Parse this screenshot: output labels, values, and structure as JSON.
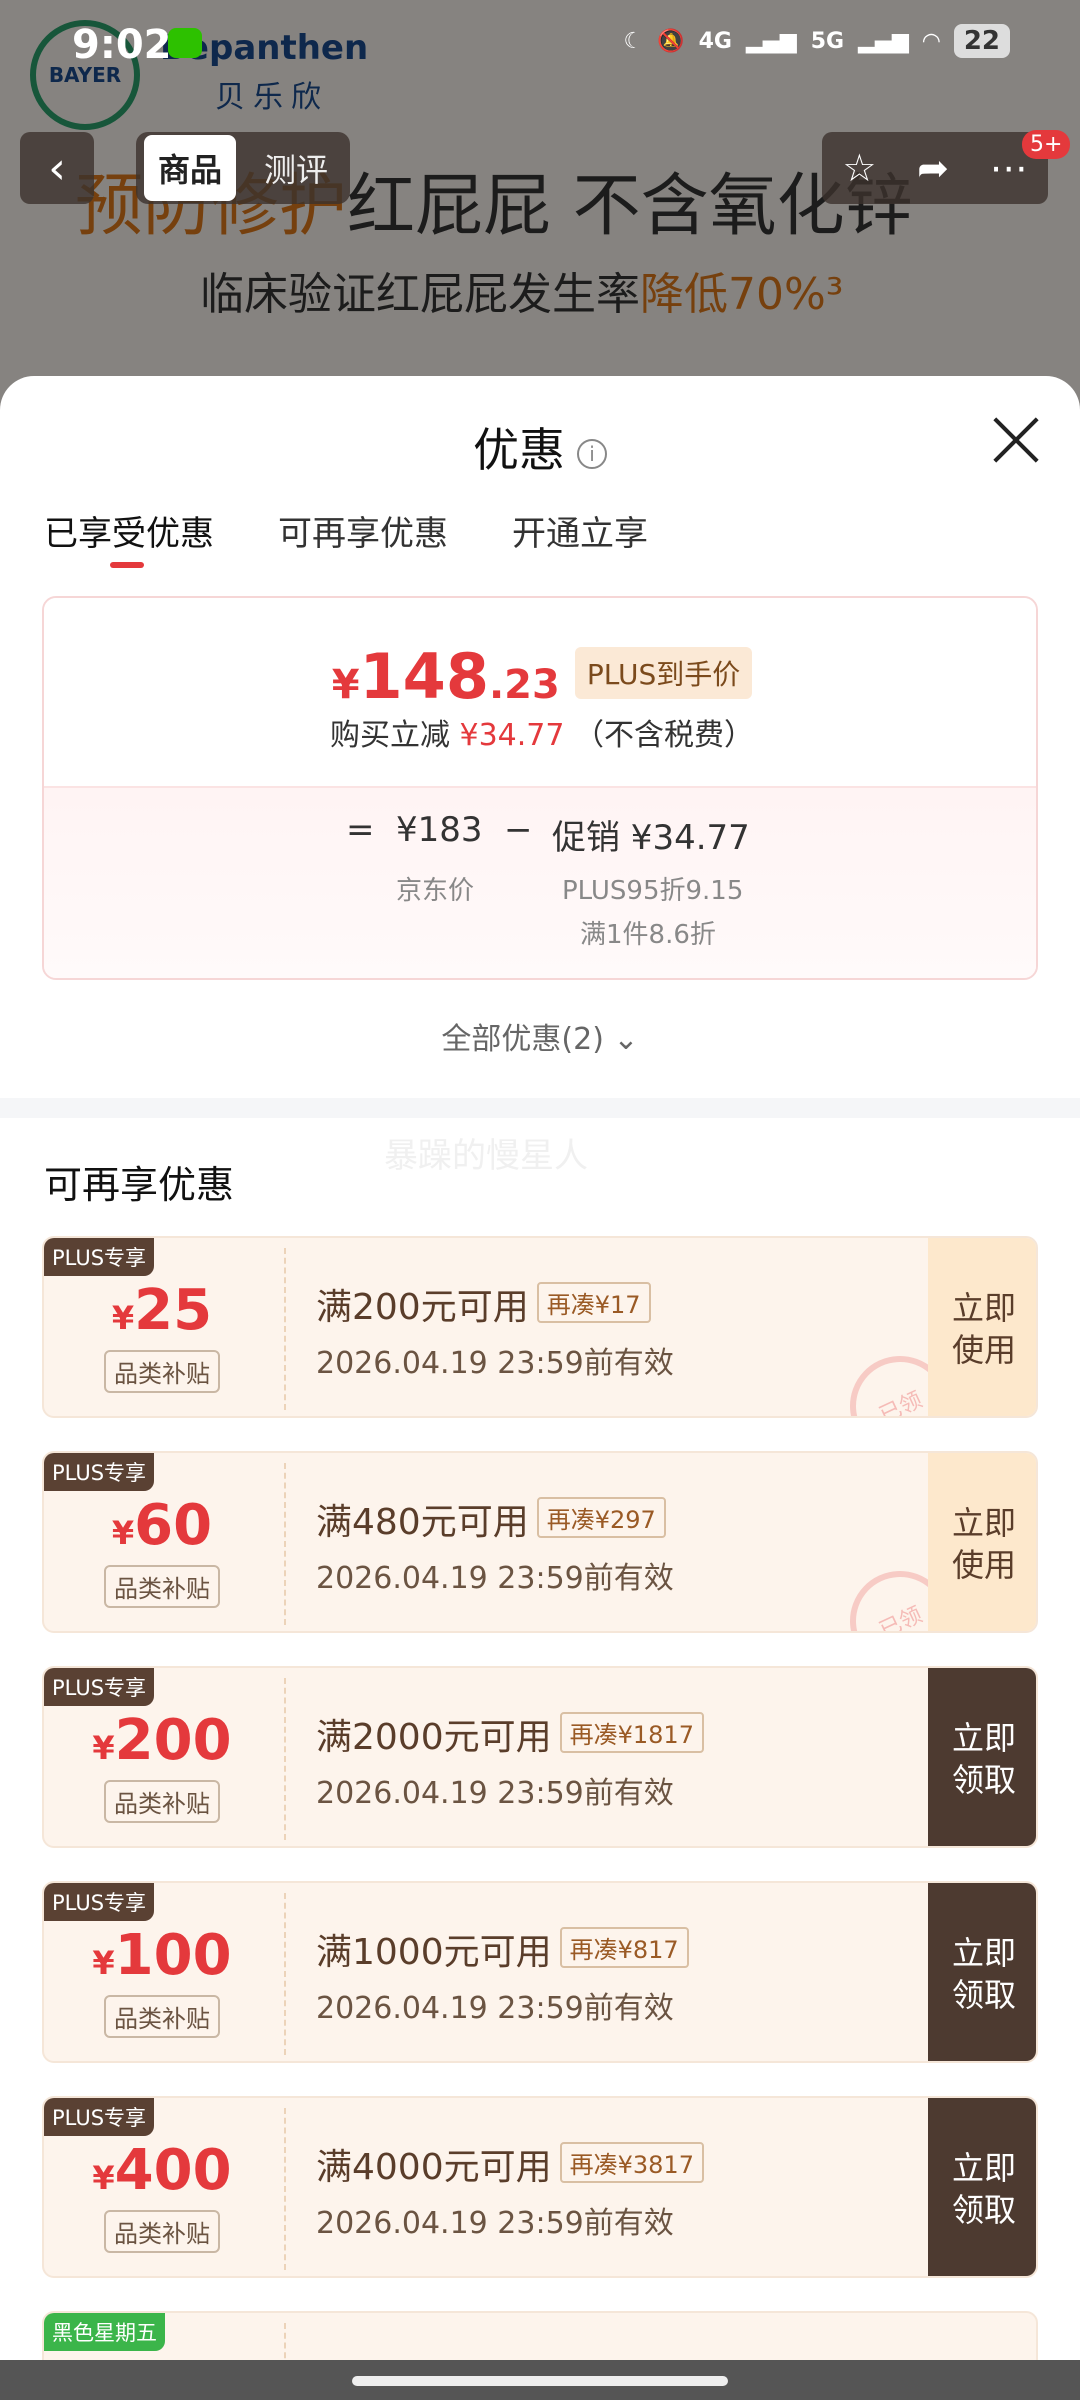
{
  "status_bar": {
    "time": "9:02",
    "net_4g": "4G",
    "net_5g": "5G",
    "battery": "22"
  },
  "background": {
    "brand": "Bepanthen",
    "brand_cn": "贝乐欣",
    "logo_text": "BAYER",
    "headline_accent": "预防修护",
    "headline_rest": "红屁屁 不含氧化锌",
    "subline_main": "临床验证红屁屁发生率",
    "subline_accent": "降低70%³"
  },
  "nav": {
    "back": "‹",
    "tab_goods": "商品",
    "tab_review": "测评",
    "badge": "5+"
  },
  "sheet": {
    "title": "优惠",
    "info_icon": "i",
    "tabs": [
      "已享受优惠",
      "可再享优惠",
      "开通立享"
    ],
    "price": {
      "currency": "¥",
      "int": "148",
      "dec": ".23",
      "plus_tag": "PLUS到手价",
      "sub_prefix": "购买立减",
      "sub_amount": "¥34.77",
      "sub_suffix": "（不含税费）"
    },
    "calc": {
      "eq": "=",
      "jd_price": "¥183",
      "minus": "−",
      "promo": "促销 ¥34.77",
      "jd_label": "京东价",
      "promo_line1": "PLUS95折9.15",
      "promo_line2": "满1件8.6折"
    },
    "all_offers": "全部优惠(2) ⌄",
    "section_title": "可再享优惠",
    "watermark": "暴躁的慢星人",
    "coupons": [
      {
        "badge": "PLUS专享",
        "amount": "25",
        "category": "品类补贴",
        "condition": "满200元可用",
        "tag": "再凑¥17",
        "expiry": "2026.04.19 23:59前有效",
        "action": "立即\n使用",
        "claimed": true,
        "stamp": "已领"
      },
      {
        "badge": "PLUS专享",
        "amount": "60",
        "category": "品类补贴",
        "condition": "满480元可用",
        "tag": "再凑¥297",
        "expiry": "2026.04.19 23:59前有效",
        "action": "立即\n使用",
        "claimed": true,
        "stamp": "已领"
      },
      {
        "badge": "PLUS专享",
        "amount": "200",
        "category": "品类补贴",
        "condition": "满2000元可用",
        "tag": "再凑¥1817",
        "expiry": "2026.04.19 23:59前有效",
        "action": "立即\n领取",
        "claimed": false
      },
      {
        "badge": "PLUS专享",
        "amount": "100",
        "category": "品类补贴",
        "condition": "满1000元可用",
        "tag": "再凑¥817",
        "expiry": "2026.04.19 23:59前有效",
        "action": "立即\n领取",
        "claimed": false
      },
      {
        "badge": "PLUS专享",
        "amount": "400",
        "category": "品类补贴",
        "condition": "满4000元可用",
        "tag": "再凑¥3817",
        "expiry": "2026.04.19 23:59前有效",
        "action": "立即\n领取",
        "claimed": false
      },
      {
        "badge": "黑色星期五",
        "amount": "",
        "category": "",
        "condition": "",
        "tag": "",
        "expiry": "",
        "action": "",
        "claimed": false,
        "partial": true
      }
    ]
  }
}
